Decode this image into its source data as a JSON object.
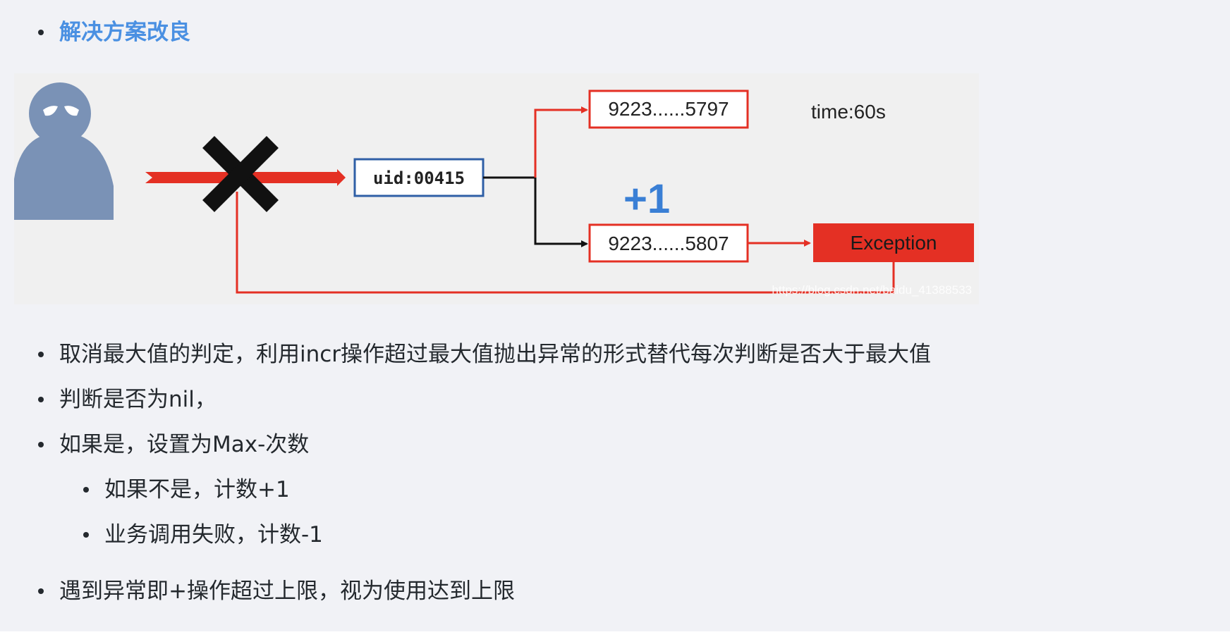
{
  "heading": {
    "label": "解决方案改良"
  },
  "diagram": {
    "uid_label": "uid:00415",
    "top_value": "9223......5797",
    "bottom_value": "9223......5807",
    "time_label": "time:60s",
    "increment_label": "+1",
    "exception_label": "Exception",
    "watermark": "https://blog.csdn.net/baidu_41388533",
    "icons": {
      "attacker": "attacker-icon",
      "blocked": "blocked-x-icon"
    },
    "colors": {
      "red": "#e43024",
      "blue_box": "#2f5fa6",
      "plus_blue": "#3a7fd5",
      "figure": "#7a92b6"
    }
  },
  "bullets": [
    "取消最大值的判定，利用incr操作超过最大值抛出异常的形式替代每次判断是否大于最大值",
    "判断是否为nil，",
    "如果是，设置为Max-次数"
  ],
  "sub_bullets": [
    "如果不是，计数+1",
    "业务调用失败，计数-1"
  ],
  "last_bullet": "遇到异常即+操作超过上限，视为使用达到上限"
}
